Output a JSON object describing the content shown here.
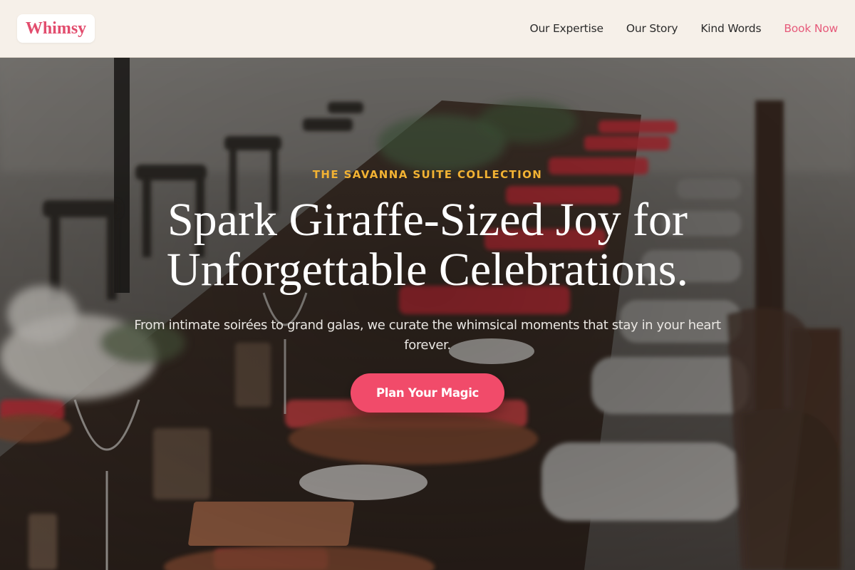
{
  "brand": {
    "name": "Whimsy",
    "color": "#e24d6e"
  },
  "nav": {
    "items": [
      {
        "label": "Our Expertise"
      },
      {
        "label": "Our Story"
      },
      {
        "label": "Kind Words"
      }
    ],
    "cta_label": "Book Now",
    "cta_color": "#e65a7a"
  },
  "hero": {
    "eyebrow": "THE SAVANNA SUITE COLLECTION",
    "headline": "Spark Giraffe-Sized Joy for Unforgettable Celebrations.",
    "subtext": "From intimate soirées to grand galas, we curate the whimsical moments that stay in your heart forever.",
    "button_label": "Plan Your Magic",
    "button_color": "#f14b6a",
    "eyebrow_color": "#f2b233",
    "background_image": "outdoor-banquet-table-photo"
  }
}
